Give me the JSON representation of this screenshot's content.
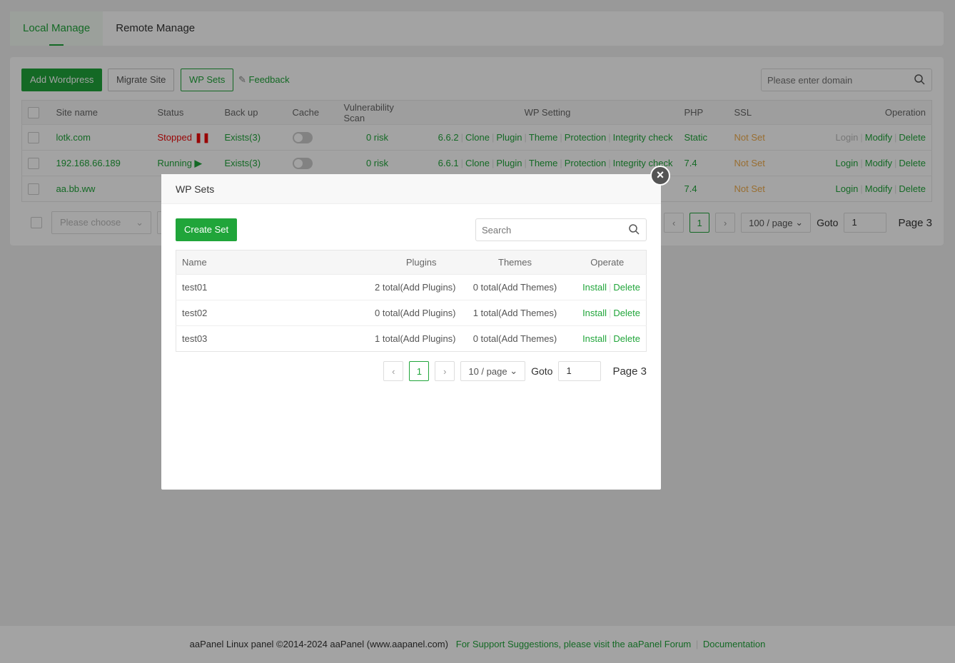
{
  "tabs": [
    {
      "label": "Local Manage",
      "active": true
    },
    {
      "label": "Remote Manage",
      "active": false
    }
  ],
  "toolbar": {
    "add": "Add Wordpress",
    "migrate": "Migrate Site",
    "wpsets": "WP Sets",
    "feedback": "Feedback",
    "search_placeholder": "Please enter domain"
  },
  "table": {
    "headers": [
      "Site name",
      "Status",
      "Back up",
      "Cache",
      "Vulnerability Scan",
      "WP Setting",
      "PHP",
      "SSL",
      "Operation"
    ],
    "rows": [
      {
        "name": "lotk.com",
        "status": "Stopped",
        "status_icon": "pause-icon",
        "backup": "Exists(3)",
        "cache": false,
        "vuln": "0 risk",
        "version": "6.6.2",
        "php": "Static",
        "ssl": "Not Set",
        "login_enabled": false
      },
      {
        "name": "192.168.66.189",
        "status": "Running",
        "status_icon": "play-icon",
        "backup": "Exists(3)",
        "cache": false,
        "vuln": "0 risk",
        "version": "6.6.1",
        "php": "7.4",
        "ssl": "Not Set",
        "login_enabled": true
      },
      {
        "name": "aa.bb.ww",
        "php": "7.4",
        "ssl": "Not Set",
        "login_enabled": true
      }
    ],
    "wp_actions": [
      "Clone",
      "Plugin",
      "Theme",
      "Protection",
      "Integrity check"
    ],
    "ops": [
      "Login",
      "Modify",
      "Delete"
    ]
  },
  "pagination": {
    "select_placeholder": "Please choose",
    "current": "1",
    "per_page": "100 / page",
    "goto_label": "Goto",
    "goto_value": "1",
    "page_label": "Page 3"
  },
  "modal": {
    "title": "WP Sets",
    "create": "Create Set",
    "search_placeholder": "Search",
    "headers": [
      "Name",
      "Plugins",
      "Themes",
      "Operate"
    ],
    "rows": [
      {
        "name": "test01",
        "plugins": "2 total(Add Plugins)",
        "themes": "0 total(Add Themes)"
      },
      {
        "name": "test02",
        "plugins": "0 total(Add Plugins)",
        "themes": "1 total(Add Themes)"
      },
      {
        "name": "test03",
        "plugins": "1 total(Add Plugins)",
        "themes": "0 total(Add Themes)"
      }
    ],
    "ops": [
      "Install",
      "Delete"
    ],
    "pagination": {
      "current": "1",
      "per_page": "10 / page",
      "goto_label": "Goto",
      "goto_value": "1",
      "page_label": "Page 3"
    }
  },
  "footer": {
    "copyright": "aaPanel Linux panel ©2014-2024 aaPanel (www.aapanel.com)",
    "support": "For Support Suggestions, please visit the aaPanel Forum",
    "docs": "Documentation"
  },
  "colors": {
    "accent": "#20a53a",
    "stopped": "#ef0808",
    "not_set": "#f0ad4e"
  }
}
